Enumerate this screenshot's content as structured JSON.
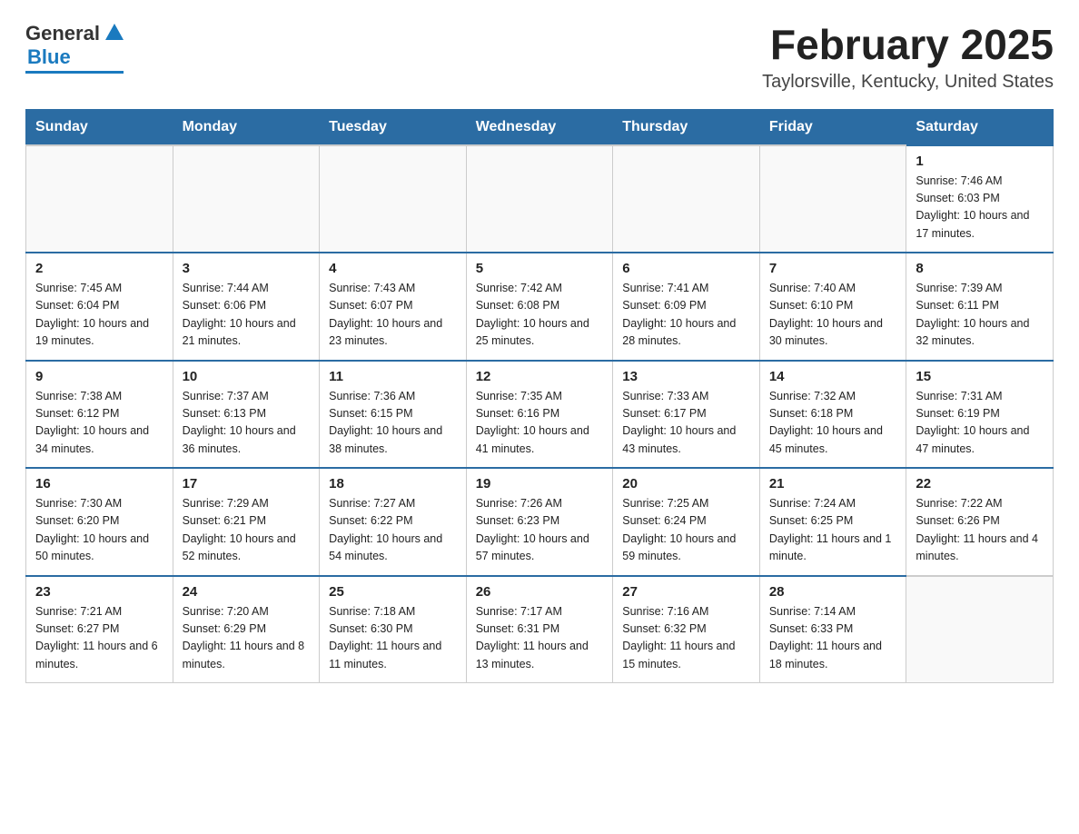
{
  "header": {
    "logo_general": "General",
    "logo_blue": "Blue",
    "month_title": "February 2025",
    "location": "Taylorsville, Kentucky, United States"
  },
  "weekdays": [
    "Sunday",
    "Monday",
    "Tuesday",
    "Wednesday",
    "Thursday",
    "Friday",
    "Saturday"
  ],
  "weeks": [
    [
      {
        "day": "",
        "info": ""
      },
      {
        "day": "",
        "info": ""
      },
      {
        "day": "",
        "info": ""
      },
      {
        "day": "",
        "info": ""
      },
      {
        "day": "",
        "info": ""
      },
      {
        "day": "",
        "info": ""
      },
      {
        "day": "1",
        "info": "Sunrise: 7:46 AM\nSunset: 6:03 PM\nDaylight: 10 hours and 17 minutes."
      }
    ],
    [
      {
        "day": "2",
        "info": "Sunrise: 7:45 AM\nSunset: 6:04 PM\nDaylight: 10 hours and 19 minutes."
      },
      {
        "day": "3",
        "info": "Sunrise: 7:44 AM\nSunset: 6:06 PM\nDaylight: 10 hours and 21 minutes."
      },
      {
        "day": "4",
        "info": "Sunrise: 7:43 AM\nSunset: 6:07 PM\nDaylight: 10 hours and 23 minutes."
      },
      {
        "day": "5",
        "info": "Sunrise: 7:42 AM\nSunset: 6:08 PM\nDaylight: 10 hours and 25 minutes."
      },
      {
        "day": "6",
        "info": "Sunrise: 7:41 AM\nSunset: 6:09 PM\nDaylight: 10 hours and 28 minutes."
      },
      {
        "day": "7",
        "info": "Sunrise: 7:40 AM\nSunset: 6:10 PM\nDaylight: 10 hours and 30 minutes."
      },
      {
        "day": "8",
        "info": "Sunrise: 7:39 AM\nSunset: 6:11 PM\nDaylight: 10 hours and 32 minutes."
      }
    ],
    [
      {
        "day": "9",
        "info": "Sunrise: 7:38 AM\nSunset: 6:12 PM\nDaylight: 10 hours and 34 minutes."
      },
      {
        "day": "10",
        "info": "Sunrise: 7:37 AM\nSunset: 6:13 PM\nDaylight: 10 hours and 36 minutes."
      },
      {
        "day": "11",
        "info": "Sunrise: 7:36 AM\nSunset: 6:15 PM\nDaylight: 10 hours and 38 minutes."
      },
      {
        "day": "12",
        "info": "Sunrise: 7:35 AM\nSunset: 6:16 PM\nDaylight: 10 hours and 41 minutes."
      },
      {
        "day": "13",
        "info": "Sunrise: 7:33 AM\nSunset: 6:17 PM\nDaylight: 10 hours and 43 minutes."
      },
      {
        "day": "14",
        "info": "Sunrise: 7:32 AM\nSunset: 6:18 PM\nDaylight: 10 hours and 45 minutes."
      },
      {
        "day": "15",
        "info": "Sunrise: 7:31 AM\nSunset: 6:19 PM\nDaylight: 10 hours and 47 minutes."
      }
    ],
    [
      {
        "day": "16",
        "info": "Sunrise: 7:30 AM\nSunset: 6:20 PM\nDaylight: 10 hours and 50 minutes."
      },
      {
        "day": "17",
        "info": "Sunrise: 7:29 AM\nSunset: 6:21 PM\nDaylight: 10 hours and 52 minutes."
      },
      {
        "day": "18",
        "info": "Sunrise: 7:27 AM\nSunset: 6:22 PM\nDaylight: 10 hours and 54 minutes."
      },
      {
        "day": "19",
        "info": "Sunrise: 7:26 AM\nSunset: 6:23 PM\nDaylight: 10 hours and 57 minutes."
      },
      {
        "day": "20",
        "info": "Sunrise: 7:25 AM\nSunset: 6:24 PM\nDaylight: 10 hours and 59 minutes."
      },
      {
        "day": "21",
        "info": "Sunrise: 7:24 AM\nSunset: 6:25 PM\nDaylight: 11 hours and 1 minute."
      },
      {
        "day": "22",
        "info": "Sunrise: 7:22 AM\nSunset: 6:26 PM\nDaylight: 11 hours and 4 minutes."
      }
    ],
    [
      {
        "day": "23",
        "info": "Sunrise: 7:21 AM\nSunset: 6:27 PM\nDaylight: 11 hours and 6 minutes."
      },
      {
        "day": "24",
        "info": "Sunrise: 7:20 AM\nSunset: 6:29 PM\nDaylight: 11 hours and 8 minutes."
      },
      {
        "day": "25",
        "info": "Sunrise: 7:18 AM\nSunset: 6:30 PM\nDaylight: 11 hours and 11 minutes."
      },
      {
        "day": "26",
        "info": "Sunrise: 7:17 AM\nSunset: 6:31 PM\nDaylight: 11 hours and 13 minutes."
      },
      {
        "day": "27",
        "info": "Sunrise: 7:16 AM\nSunset: 6:32 PM\nDaylight: 11 hours and 15 minutes."
      },
      {
        "day": "28",
        "info": "Sunrise: 7:14 AM\nSunset: 6:33 PM\nDaylight: 11 hours and 18 minutes."
      },
      {
        "day": "",
        "info": ""
      }
    ]
  ]
}
